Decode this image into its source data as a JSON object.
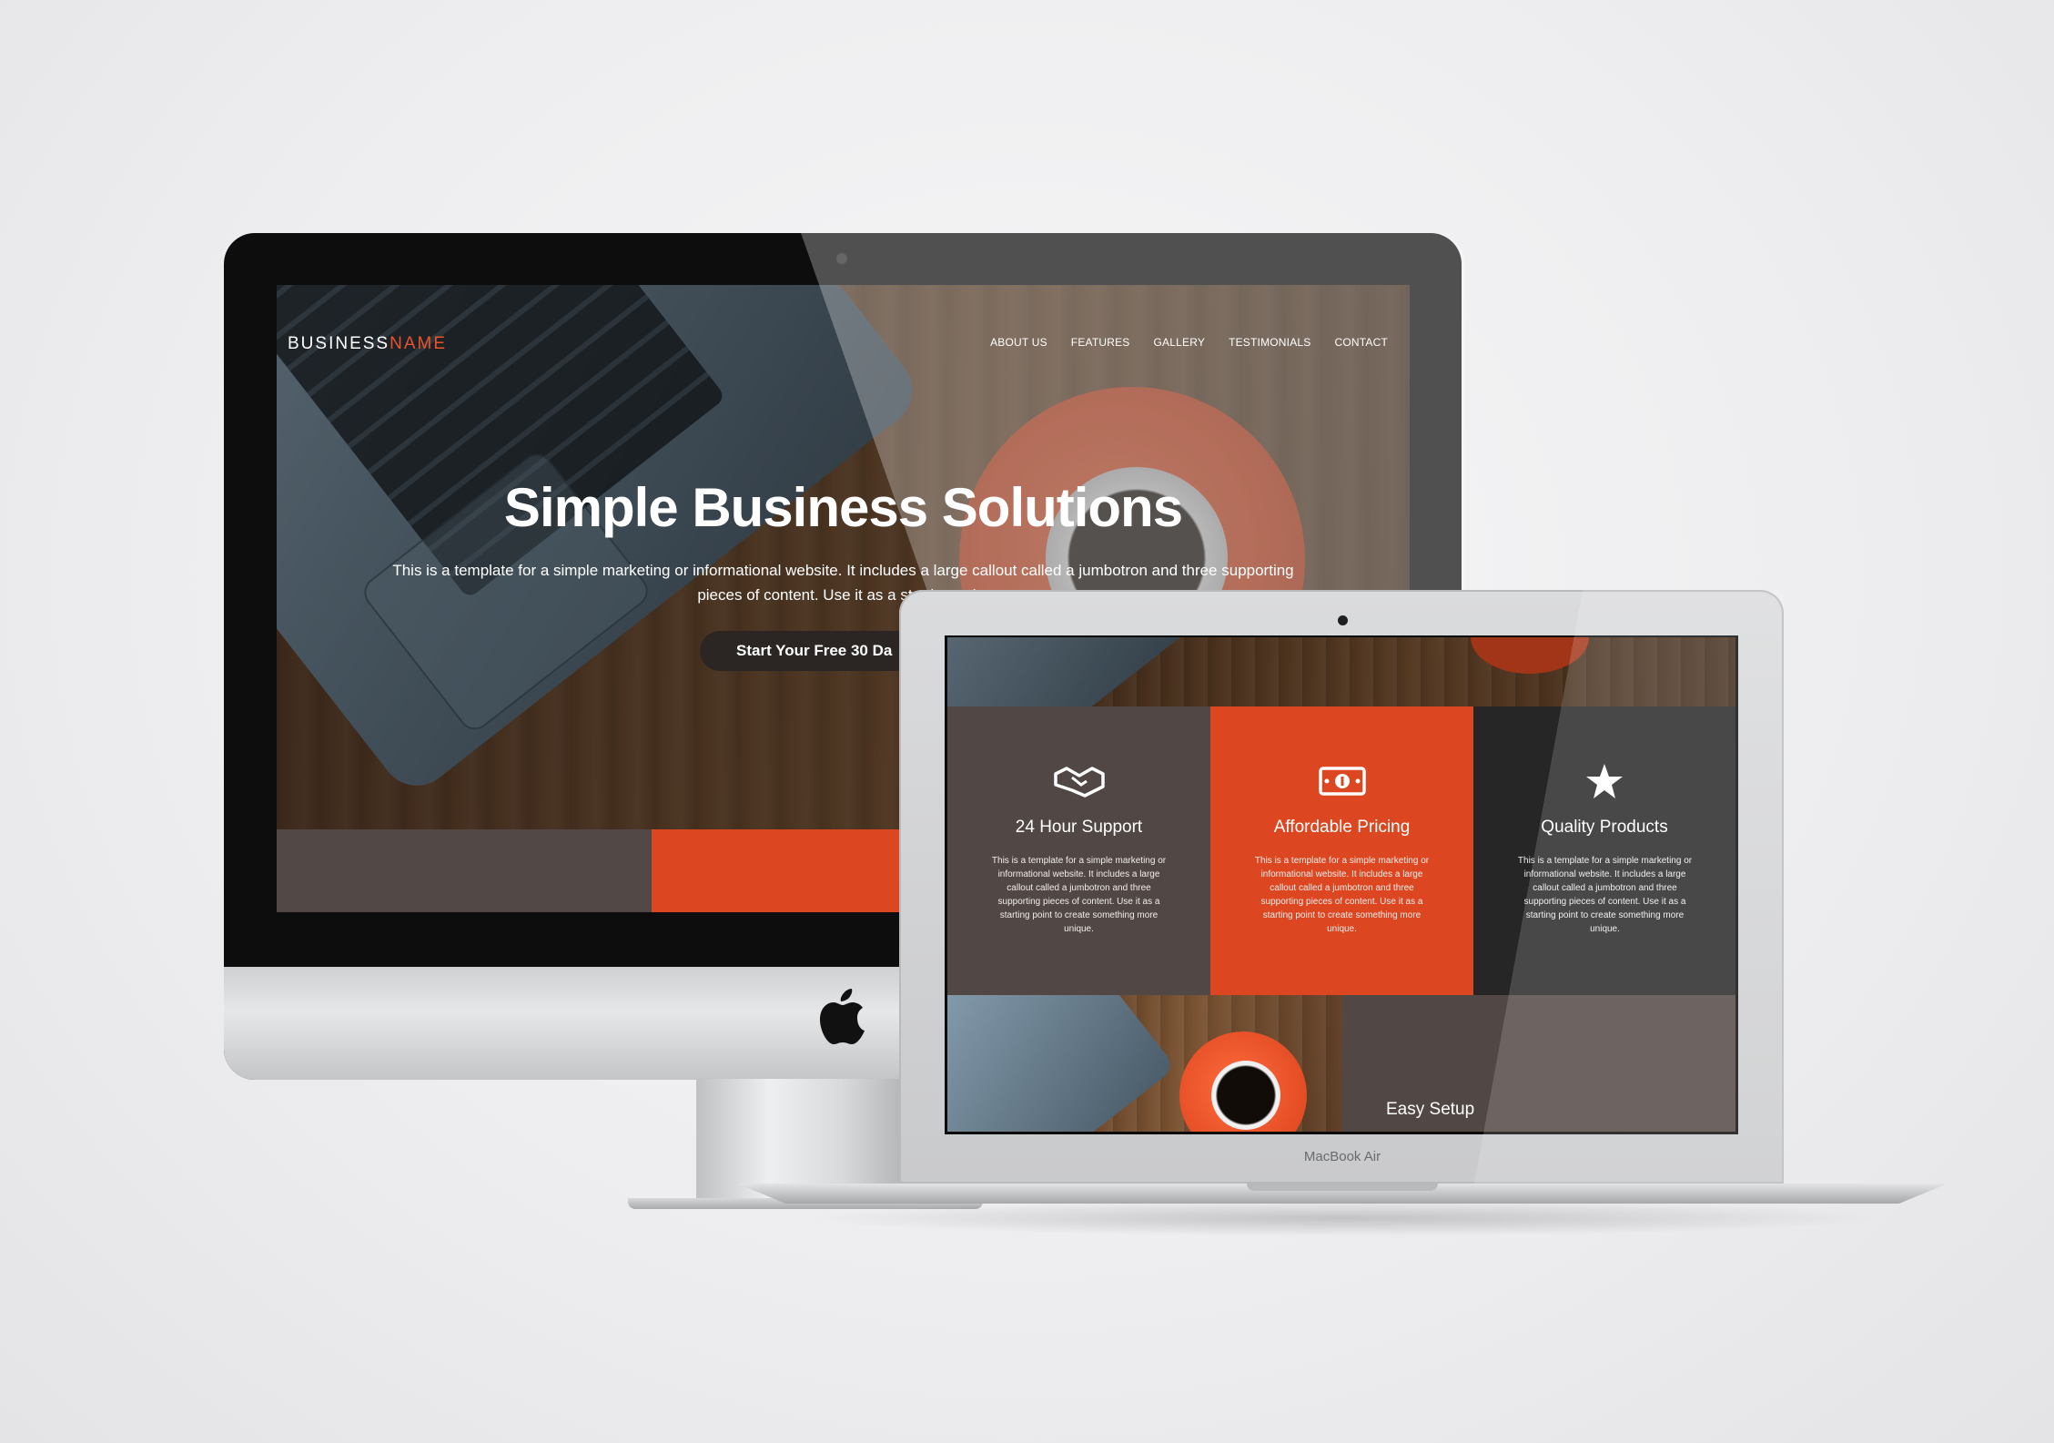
{
  "imac_site": {
    "brand_part1": "BUSINESS",
    "brand_part2": "NAME",
    "nav": [
      "ABOUT US",
      "FEATURES",
      "GALLERY",
      "TESTIMONIALS",
      "CONTACT"
    ],
    "hero_title": "Simple Business Solutions",
    "hero_text": "This is a template for a simple marketing or informational website. It includes a large callout called a jumbotron and three supporting pieces of content. Use it as a starting point",
    "cta_label": "Start Your Free 30 Da"
  },
  "macbook_site": {
    "features": [
      {
        "icon": "handshake-icon",
        "title": "24 Hour Support",
        "body": "This is a template for a simple marketing or informational website. It includes a large callout called a jumbotron and three supporting pieces of content. Use it as a starting point to create something more unique."
      },
      {
        "icon": "money-icon",
        "title": "Affordable Pricing",
        "body": "This is a template for a simple marketing or informational website. It includes a large callout called a jumbotron and three supporting pieces of content. Use it as a starting point to create something more unique."
      },
      {
        "icon": "star-icon",
        "title": "Quality Products",
        "body": "This is a template for a simple marketing or informational website. It includes a large callout called a jumbotron and three supporting pieces of content. Use it as a starting point to create something more unique."
      }
    ],
    "easy_setup": "Easy Setup"
  },
  "device_label": "MacBook Air",
  "colors": {
    "accent": "#dc4620",
    "brown": "#514744",
    "dark": "#262626"
  }
}
